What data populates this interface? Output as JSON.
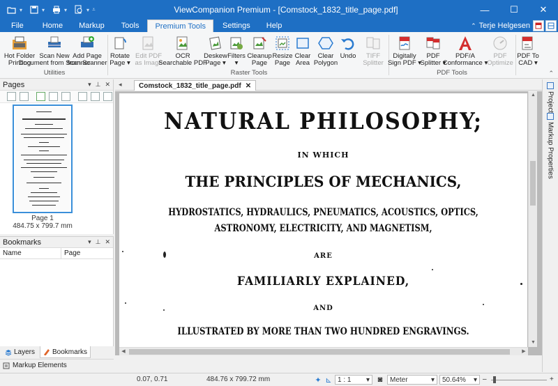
{
  "window": {
    "title": "ViewCompanion Premium - [Comstock_1832_title_page.pdf]",
    "controls": [
      "—",
      "☐",
      "✕"
    ]
  },
  "quick_access": [
    "open-icon",
    "save-icon",
    "print-icon",
    "find-icon",
    "customize-icon"
  ],
  "menu_tabs": [
    {
      "label": "File",
      "active": false
    },
    {
      "label": "Home",
      "active": false
    },
    {
      "label": "Markup",
      "active": false
    },
    {
      "label": "Tools",
      "active": false
    },
    {
      "label": "Premium Tools",
      "active": true
    },
    {
      "label": "Settings",
      "active": false
    },
    {
      "label": "Help",
      "active": false
    }
  ],
  "user": {
    "name": "Terje Helgesen"
  },
  "ribbon": {
    "utilities": {
      "label": "Utilities",
      "buttons": [
        {
          "line1": "Hot Folder",
          "line2": "Printing"
        },
        {
          "line1": "Scan New",
          "line2": "Document from Scanner"
        },
        {
          "line1": "Add Page",
          "line2": "from Scanner"
        }
      ]
    },
    "raster": {
      "label": "Raster Tools",
      "buttons": [
        {
          "line1": "Rotate",
          "line2": "Page ▾"
        },
        {
          "line1": "Edit PDF",
          "line2": "as Image"
        },
        {
          "line1": "OCR",
          "line2": "Searchable PDF"
        },
        {
          "line1": "Deskew",
          "line2": "Page ▾"
        },
        {
          "line1": "Filters",
          "line2": "▾"
        },
        {
          "line1": "Cleanup",
          "line2": "Page"
        },
        {
          "line1": "Resize",
          "line2": "Page"
        },
        {
          "line1": "Clear",
          "line2": "Area"
        },
        {
          "line1": "Clear",
          "line2": "Polygon"
        },
        {
          "line1": "Undo",
          "line2": ""
        },
        {
          "line1": "TIFF",
          "line2": "Splitter"
        }
      ]
    },
    "pdf": {
      "label": "PDF Tools",
      "buttons": [
        {
          "line1": "Digitally",
          "line2": "Sign PDF ▾"
        },
        {
          "line1": "PDF",
          "line2": "Splitter ▾"
        },
        {
          "line1": "PDF/A",
          "line2": "Conformance ▾"
        },
        {
          "line1": "PDF",
          "line2": "Optimize"
        },
        {
          "line1": "PDF To",
          "line2": "CAD ▾"
        }
      ]
    },
    "colors": {
      "accent": "#1e6fc4",
      "pdf_red": "#d32f2f",
      "scan_blue": "#2f6db3"
    }
  },
  "pages_panel": {
    "title": "Pages",
    "thumbnail": {
      "caption": "Page 1",
      "size": "484.75 x 799.7 mm"
    }
  },
  "bookmarks_panel": {
    "title": "Bookmarks",
    "columns": [
      "Name",
      "Page"
    ]
  },
  "left_tabs": [
    {
      "label": "Layers",
      "active": false
    },
    {
      "label": "Bookmarks",
      "active": true
    }
  ],
  "markup_elements": {
    "label": "Markup Elements"
  },
  "document": {
    "tab_label": "Comstock_1832_title_page.pdf",
    "lines": [
      "NATURAL PHILOSOPHY;",
      "IN WHICH",
      "THE PRINCIPLES OF MECHANICS,",
      "HYDROSTATICS, HYDRAULICS, PNEUMATICS, ACOUSTICS, OPTICS,",
      "ASTRONOMY, ELECTRICITY, AND MAGNETISM,",
      "ARE",
      "FAMILIARLY EXPLAINED,",
      "AND",
      "ILLUSTRATED BY MORE THAN TWO HUNDRED ENGRAVINGS."
    ]
  },
  "right_tabs": [
    {
      "label": "Project"
    },
    {
      "label": "Markup Properties"
    }
  ],
  "statusbar": {
    "coords": "0.07, 0.71",
    "page_size": "484.76 x 799.72 mm",
    "scale": "1 : 1",
    "unit": "Meter",
    "zoom": "50.64%",
    "zoom_fraction": 0.06
  }
}
